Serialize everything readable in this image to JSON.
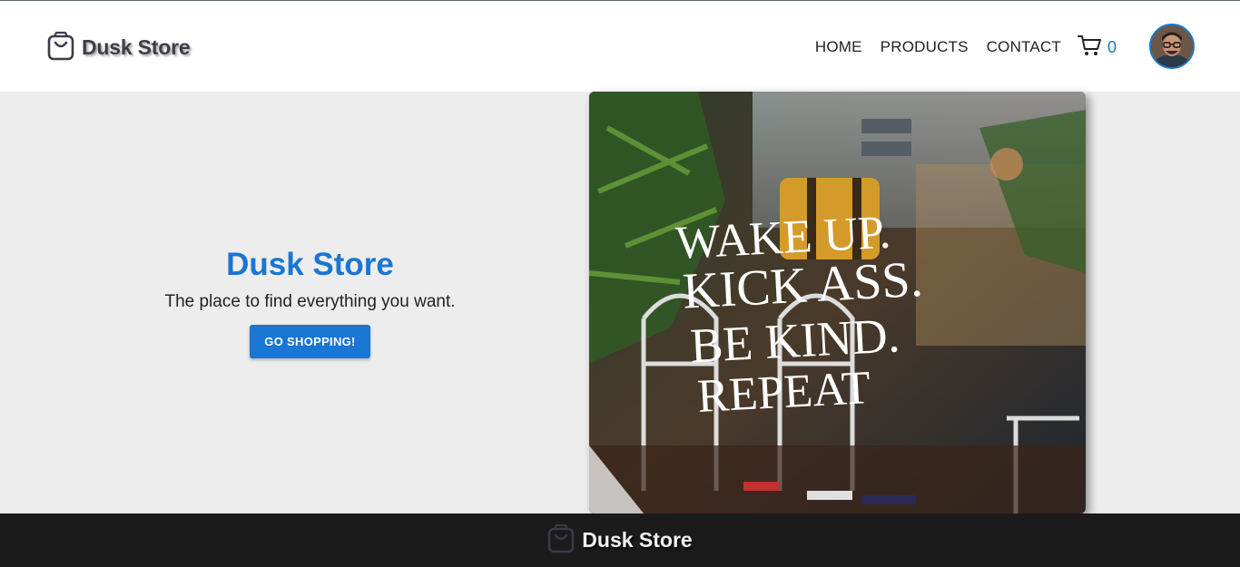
{
  "header": {
    "brand": "Dusk Store",
    "nav": [
      {
        "label": "HOME"
      },
      {
        "label": "PRODUCTS"
      },
      {
        "label": "CONTACT"
      }
    ],
    "cart_count": "0",
    "cart_icon": "cart-icon",
    "logo_icon": "shopping-bag-icon"
  },
  "hero": {
    "title": "Dusk Store",
    "subtitle": "The place to find everything you want.",
    "button": "GO SHOPPING!",
    "image_quote": [
      "WAKE UP.",
      "KICK ASS.",
      "BE KIND.",
      "REPEAT"
    ]
  },
  "footer": {
    "brand": "Dusk Store"
  },
  "colors": {
    "accent": "#1976d2",
    "header_bg": "#ffffff",
    "hero_bg": "#ededed",
    "footer_bg": "#1b1b1b"
  }
}
